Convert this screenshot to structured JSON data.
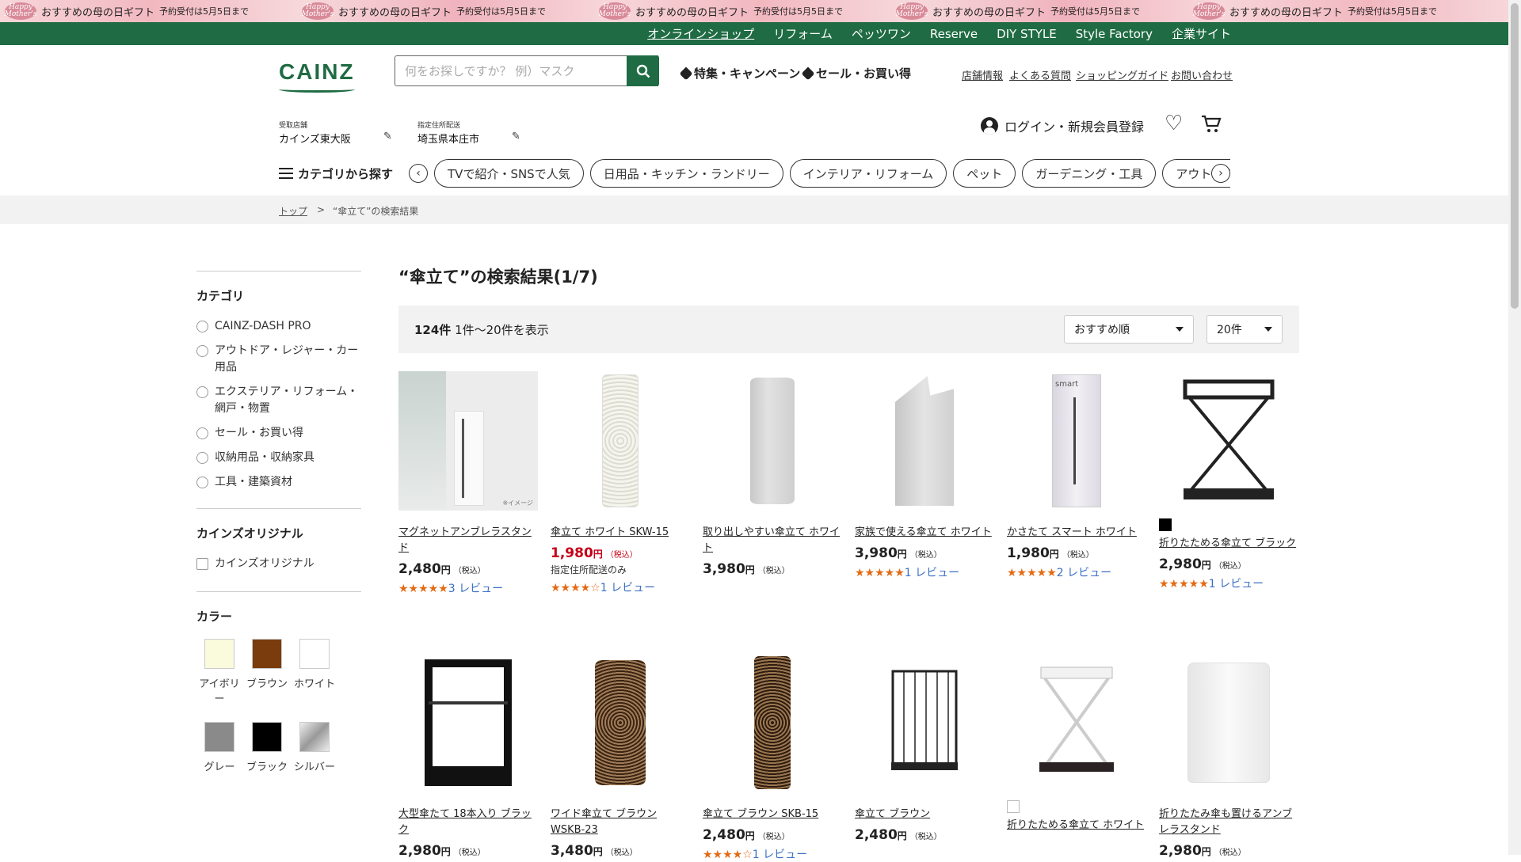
{
  "banner": {
    "segments": [
      {
        "main": "おすすめの母の日ギフト",
        "sub": "予約受付は5月5日まで"
      },
      {
        "main": "おすすめの母の日ギフト",
        "sub": "予約受付は5月5日まで"
      },
      {
        "main": "おすすめの母の日ギフト",
        "sub": "予約受付は5月5日まで"
      },
      {
        "main": "おすすめの母の日ギフト",
        "sub": "予約受付は5月5日まで"
      },
      {
        "main": "おすすめの母の日ギフト",
        "sub": "予約受付は5月5日まで"
      }
    ]
  },
  "topnav": [
    "オンラインショップ",
    "リフォーム",
    "ペッツワン",
    "Reserve",
    "DIY STYLE",
    "Style Factory",
    "企業サイト"
  ],
  "header": {
    "logo": "CAINZ",
    "search_placeholder": "何をお探しですか？ 例）マスク",
    "feature_links": [
      "特集・キャンペーン",
      "セール・お買い得"
    ],
    "util_links": [
      "店舗情報",
      "よくある質問",
      "ショッピングガイド",
      "お問い合わせ"
    ],
    "store_label": "受取店舗",
    "store_value": "カインズ東大阪",
    "address_label": "指定住所配送",
    "address_value": "埼玉県本庄市",
    "login": "ログイン・新規会員登録"
  },
  "categories": {
    "menu_label": "カテゴリから探す",
    "chips": [
      "TVで紹介・SNSで人気",
      "日用品・キッチン・ランドリー",
      "インテリア・リフォーム",
      "ペット",
      "ガーデニング・工具",
      "アウトドア・カ"
    ]
  },
  "breadcrumb": {
    "home": "トップ",
    "sep": ">",
    "current": "“傘立て”の検索結果"
  },
  "sidebar": {
    "category_title": "カテゴリ",
    "categories": [
      "CAINZ-DASH PRO",
      "アウトドア・レジャー・カー用品",
      "エクステリア・リフォーム・網戸・物置",
      "セール・お買い得",
      "収納用品・収納家具",
      "工具・建築資材"
    ],
    "original_title": "カインズオリジナル",
    "original_option": "カインズオリジナル",
    "color_title": "カラー",
    "colors": [
      {
        "label": "アイボリー",
        "hex": "#fafadc"
      },
      {
        "label": "ブラウン",
        "hex": "#7a3c0c"
      },
      {
        "label": "ホワイト",
        "hex": "#ffffff"
      },
      {
        "label": "グレー",
        "hex": "#8a8a8a"
      },
      {
        "label": "ブラック",
        "hex": "#000000"
      },
      {
        "label": "シルバー",
        "hex": "#c8c8c8"
      }
    ]
  },
  "results": {
    "title": "“傘立て”の検索結果(1/7)",
    "count": "124件",
    "range": "1件～20件を表示",
    "sort": "おすすめ順",
    "per_page": "20件"
  },
  "products_row1": [
    {
      "name": "マグネットアンブレラスタンド",
      "price": "2,480",
      "yen": "円",
      "tax": "（税込）",
      "stars": "★★★★★",
      "reviews": "3 レビュー",
      "note": "※イメージ"
    },
    {
      "name": "傘立て ホワイト SKW-15",
      "price": "1,980",
      "yen": "円",
      "tax": "（税込）",
      "ship": "指定住所配送のみ",
      "stars": "★★★★☆",
      "reviews": "1 レビュー"
    },
    {
      "name": "取り出しやすい傘立て ホワイト",
      "price": "3,980",
      "yen": "円",
      "tax": "（税込）"
    },
    {
      "name": "家族で使える傘立て ホワイト",
      "price": "3,980",
      "yen": "円",
      "tax": "（税込）",
      "stars": "★★★★★",
      "reviews": "1 レビュー"
    },
    {
      "name": "かさたて スマート ホワイト",
      "price": "1,980",
      "yen": "円",
      "tax": "（税込）",
      "stars": "★★★★★",
      "reviews": "2 レビュー",
      "box_text": "smart"
    },
    {
      "name": "折りたためる傘立て ブラック",
      "price": "2,980",
      "yen": "円",
      "tax": "（税込）",
      "stars": "★★★★★",
      "reviews": "1 レビュー"
    }
  ],
  "products_row2": [
    {
      "name": "大型傘たて 18本入り ブラック",
      "price": "2,980",
      "yen": "円",
      "tax": "（税込）"
    },
    {
      "name": "ワイド傘立て ブラウン WSKB-23",
      "price": "3,480",
      "yen": "円",
      "tax": "（税込）"
    },
    {
      "name": "傘立て ブラウン SKB-15",
      "price": "2,480",
      "yen": "円",
      "tax": "（税込）",
      "stars": "★★★★☆",
      "reviews": "1 レビュー"
    },
    {
      "name": "傘立て ブラウン",
      "price": "2,480",
      "yen": "円",
      "tax": "（税込）"
    },
    {
      "name": "折りたためる傘立て ホワイト",
      "price": "",
      "yen": "",
      "tax": ""
    },
    {
      "name": "折りたたみ傘も置けるアンブレラスタンド",
      "price": "2,980",
      "yen": "円",
      "tax": "（税込）"
    }
  ],
  "colors": {
    "brand": "#1f6b43",
    "sale": "#c40018",
    "star": "#e36a13",
    "link": "#3a6fc4"
  }
}
